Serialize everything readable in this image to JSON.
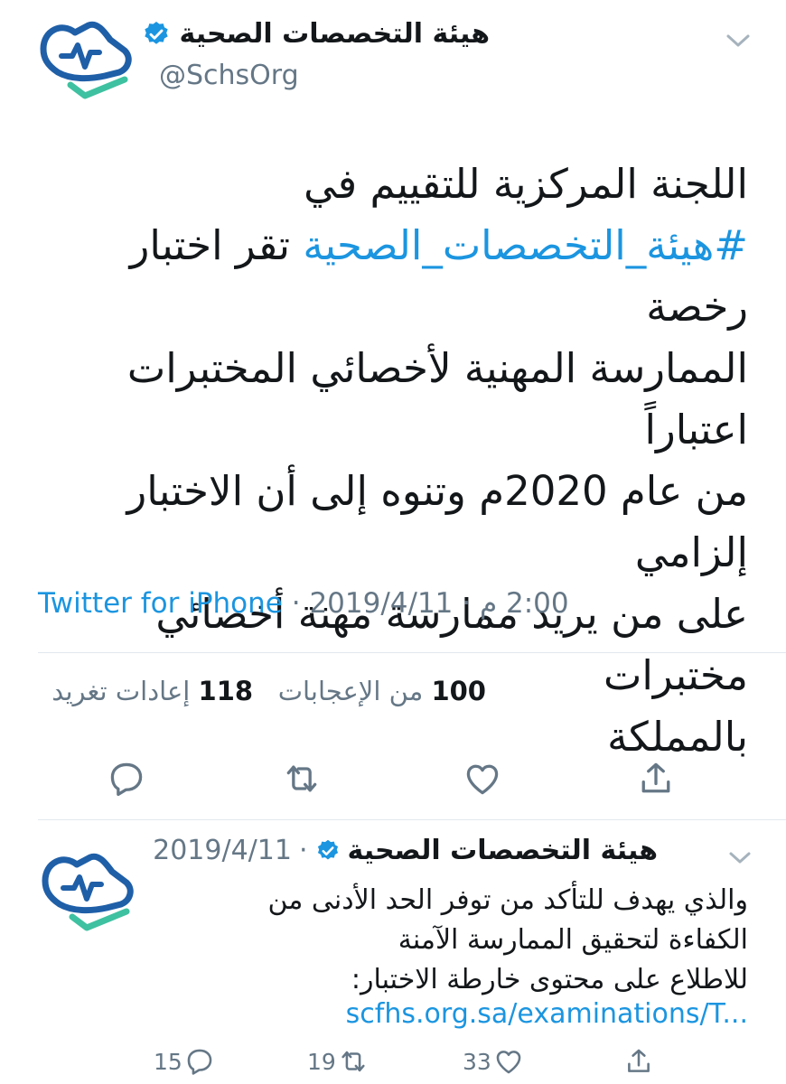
{
  "colors": {
    "accent": "#1b95e0",
    "text": "#14171a",
    "muted": "#657786",
    "logo_blue": "#1f5fa8",
    "logo_green": "#3ec1a0"
  },
  "tweet": {
    "author_name": "هيئة التخصصات الصحية",
    "handle": "@SchsOrg",
    "body_line1": "اللجنة المركزية للتقييم في",
    "hashtag": "#هيئة_التخصصات_الصحية",
    "body_line2_rest": " تقر اختبار رخصة",
    "body_line3": "الممارسة المهنية لأخصائي المختبرات اعتباراً",
    "body_line4": "من عام 2020م وتنوه إلى أن الاختبار إلزامي",
    "body_line5": "على من يريد ممارسة مهنة أخصائي مختبرات",
    "body_line6": "بالمملكة",
    "source": "Twitter for iPhone",
    "separator": " · ",
    "date": "2019/4/11",
    "time": "2:00 م",
    "likes_count": "100",
    "likes_label": "من الإعجابات",
    "retweets_count": "118",
    "retweets_label": "إعادات تغريد",
    "icons": [
      "reply-icon",
      "retweet-icon",
      "like-icon",
      "share-icon",
      "verified-icon",
      "chevron-down-icon"
    ]
  },
  "reply_tweet": {
    "author_name": "هيئة التخصصات الصحية",
    "date": "2019/4/11",
    "dot": "·",
    "line1": "والذي يهدف للتأكد من توفر الحد الأدنى من",
    "line2": "الكفاءة لتحقيق الممارسة الآمنة",
    "line3": "للاطلاع على محتوى خارطة الاختبار:",
    "link": "scfhs.org.sa/examinations/T...",
    "reply_count": "15",
    "retweet_count": "19",
    "like_count": "33"
  }
}
